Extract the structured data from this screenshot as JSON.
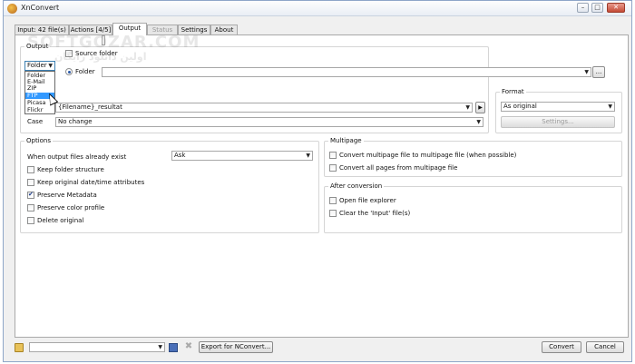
{
  "window": {
    "title": "XnConvert",
    "minimize": "–",
    "maximize": "□",
    "close": "✕"
  },
  "tabs": [
    {
      "label": "Input: 42 file(s)"
    },
    {
      "label": "Actions [4/5]"
    },
    {
      "label": "Output"
    },
    {
      "label": "Status"
    },
    {
      "label": "Settings"
    },
    {
      "label": "About"
    }
  ],
  "output": {
    "group_title": "Output",
    "destination_selected": "Folder",
    "destination_options": [
      "Folder",
      "E-Mail",
      "ZIP",
      "FTP",
      "Picasa",
      "Flickr"
    ],
    "highlighted_option": "FTP",
    "source_folder_label": "Source folder",
    "folder_label": "Folder",
    "folder_path": "",
    "browse_label": "...",
    "filename_value": "{Filename}_resultat",
    "case_label": "Case",
    "case_value": "No change"
  },
  "format": {
    "group_title": "Format",
    "value": "As original",
    "settings_label": "Settings..."
  },
  "options": {
    "group_title": "Options",
    "exist_label": "When output files already exist",
    "exist_value": "Ask",
    "keep_folder_structure": "Keep folder structure",
    "keep_original_date": "Keep original date/time attributes",
    "preserve_metadata": "Preserve Metadata",
    "preserve_color_profile": "Preserve color profile",
    "delete_original": "Delete original"
  },
  "multipage": {
    "group_title": "Multipage",
    "convert_multipage": "Convert multipage file to multipage file (when possible)",
    "convert_all_pages": "Convert all pages from multipage file"
  },
  "after_conversion": {
    "group_title": "After conversion",
    "open_explorer": "Open file explorer",
    "clear_input": "Clear the 'Input' file(s)"
  },
  "footer": {
    "preset_value": "",
    "export_label": "Export for NConvert...",
    "convert_label": "Convert",
    "cancel_label": "Cancel"
  },
  "watermark": {
    "latin": "SOFTGOZAR.COM",
    "persian": "اولین دانلود رایگان"
  }
}
